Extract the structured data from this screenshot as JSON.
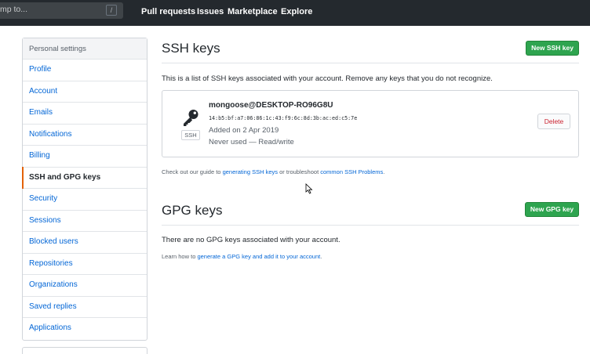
{
  "header": {
    "search_placeholder": "mp to...",
    "search_shortcut": "/",
    "nav": [
      "Pull requests",
      "Issues",
      "Marketplace",
      "Explore"
    ]
  },
  "sidebar": {
    "heading": "Personal settings",
    "items": [
      {
        "label": "Profile"
      },
      {
        "label": "Account"
      },
      {
        "label": "Emails"
      },
      {
        "label": "Notifications"
      },
      {
        "label": "Billing"
      },
      {
        "label": "SSH and GPG keys",
        "selected": true
      },
      {
        "label": "Security"
      },
      {
        "label": "Sessions"
      },
      {
        "label": "Blocked users"
      },
      {
        "label": "Repositories"
      },
      {
        "label": "Organizations"
      },
      {
        "label": "Saved replies"
      },
      {
        "label": "Applications"
      }
    ]
  },
  "ssh": {
    "title": "SSH keys",
    "new_button": "New SSH key",
    "description": "This is a list of SSH keys associated with your account. Remove any keys that you do not recognize.",
    "key": {
      "name": "mongoose@DESKTOP-RO96G8U",
      "fingerprint": "14:b5:bf:a7:06:86:1c:43:f9:6c:8d:3b:ac:ed:c5:7e",
      "added": "Added on 2 Apr 2019",
      "usage": "Never used — Read/write",
      "badge": "SSH",
      "delete_label": "Delete"
    },
    "guide_prefix": "Check out our guide to ",
    "guide_link": "generating SSH keys",
    "guide_middle": " or troubleshoot ",
    "guide_link2": "common SSH Problems",
    "guide_suffix": "."
  },
  "gpg": {
    "title": "GPG keys",
    "new_button": "New GPG key",
    "empty_text": "There are no GPG keys associated with your account.",
    "learn_prefix": "Learn how to ",
    "learn_link": "generate a GPG key and add it to your account",
    "learn_suffix": "."
  },
  "colors": {
    "header_bg": "#24292e",
    "link": "#0366d6",
    "green_button": "#2ea44f",
    "danger": "#cb2431",
    "selected_marker": "#e36209"
  },
  "icons": {
    "key": "key-icon",
    "cursor": "mouse-cursor-icon"
  }
}
